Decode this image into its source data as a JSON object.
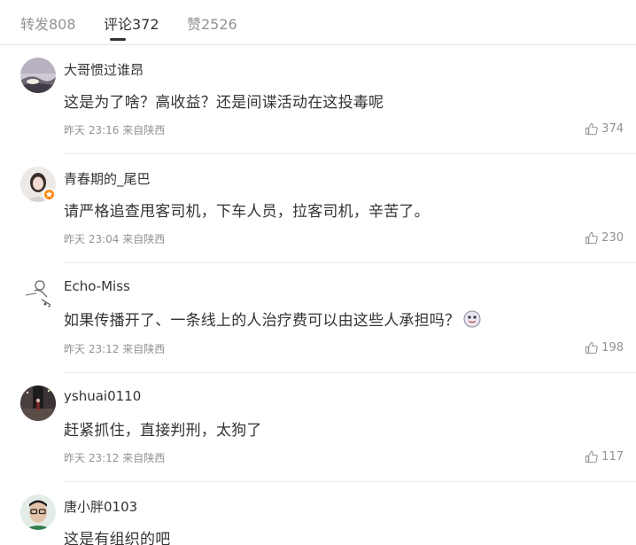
{
  "tabs": [
    {
      "label": "转发808",
      "active": false
    },
    {
      "label": "评论372",
      "active": true
    },
    {
      "label": "赞2526",
      "active": false
    }
  ],
  "comments": [
    {
      "username": "大哥惯过谁昂",
      "text": "这是为了啥？高收益？还是间谍活动在这投毒呢",
      "meta": "昨天 23:16 来自陕西",
      "likes": "374",
      "avatar": "landscape-avatar"
    },
    {
      "username": "青春期的_尾巴",
      "text": "请严格追查甩客司机，下车人员，拉客司机，辛苦了。",
      "meta": "昨天 23:04 来自陕西",
      "likes": "230",
      "avatar": "girl-avatar",
      "badge": "orange-badge"
    },
    {
      "username": "Echo-Miss",
      "text": "如果传播开了、一条线上的人治疗费可以由这些人承担吗？",
      "meta": "昨天 23:12 来自陕西",
      "likes": "198",
      "avatar": "sketch-avatar",
      "emoji": "doge-emoji"
    },
    {
      "username": "yshuai0110",
      "text": "赶紧抓住，直接判刑，太狗了",
      "meta": "昨天 23:12 来自陕西",
      "likes": "117",
      "avatar": "night-street-avatar"
    },
    {
      "username": "唐小胖0103",
      "text": "这是有组织的吧",
      "meta": "",
      "likes": "",
      "avatar": "man-glasses-avatar"
    }
  ],
  "colors": {
    "text": "#333333",
    "muted": "#939393",
    "badge": "#ff8200",
    "divider": "#ececec"
  },
  "icons": {
    "like": "thumbs-up-icon"
  }
}
